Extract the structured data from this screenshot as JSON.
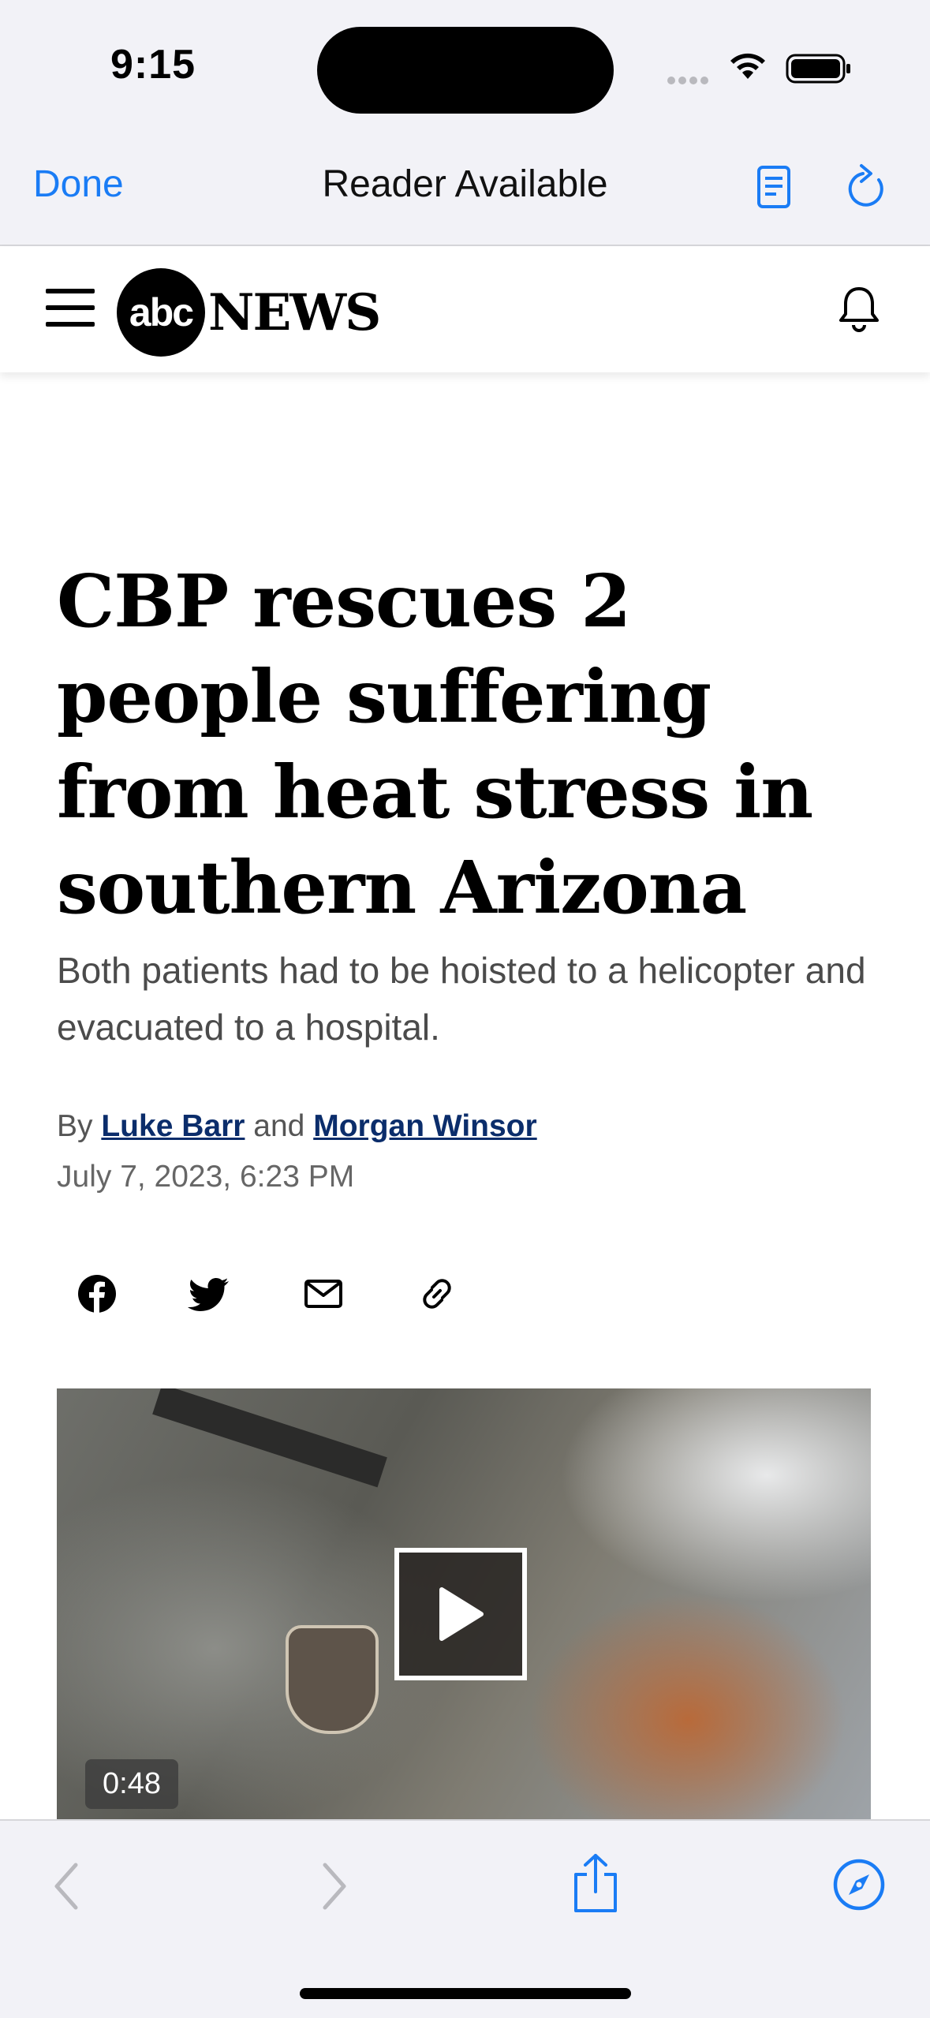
{
  "status_bar": {
    "time": "9:15"
  },
  "browser": {
    "done_label": "Done",
    "title": "Reader Available"
  },
  "site": {
    "logo_abc": "abc",
    "logo_news": "NEWS"
  },
  "article": {
    "headline": "CBP rescues 2 people suffering from heat stress in southern Arizona",
    "subheadline": "Both patients had to be hoisted to a helicopter and evacuated to a hospital.",
    "by_prefix": "By",
    "author1": "Luke Barr",
    "and_text": "and",
    "author2": "Morgan Winsor",
    "date": "July 7, 2023, 6:23 PM",
    "share_icons": [
      "facebook-icon",
      "twitter-icon",
      "mail-icon",
      "link-icon"
    ]
  },
  "video": {
    "duration": "0:48"
  },
  "colors": {
    "accent": "#1a7cf5",
    "author_link": "#0b2d6b",
    "toolbar_bg": "#f2f2f7"
  }
}
